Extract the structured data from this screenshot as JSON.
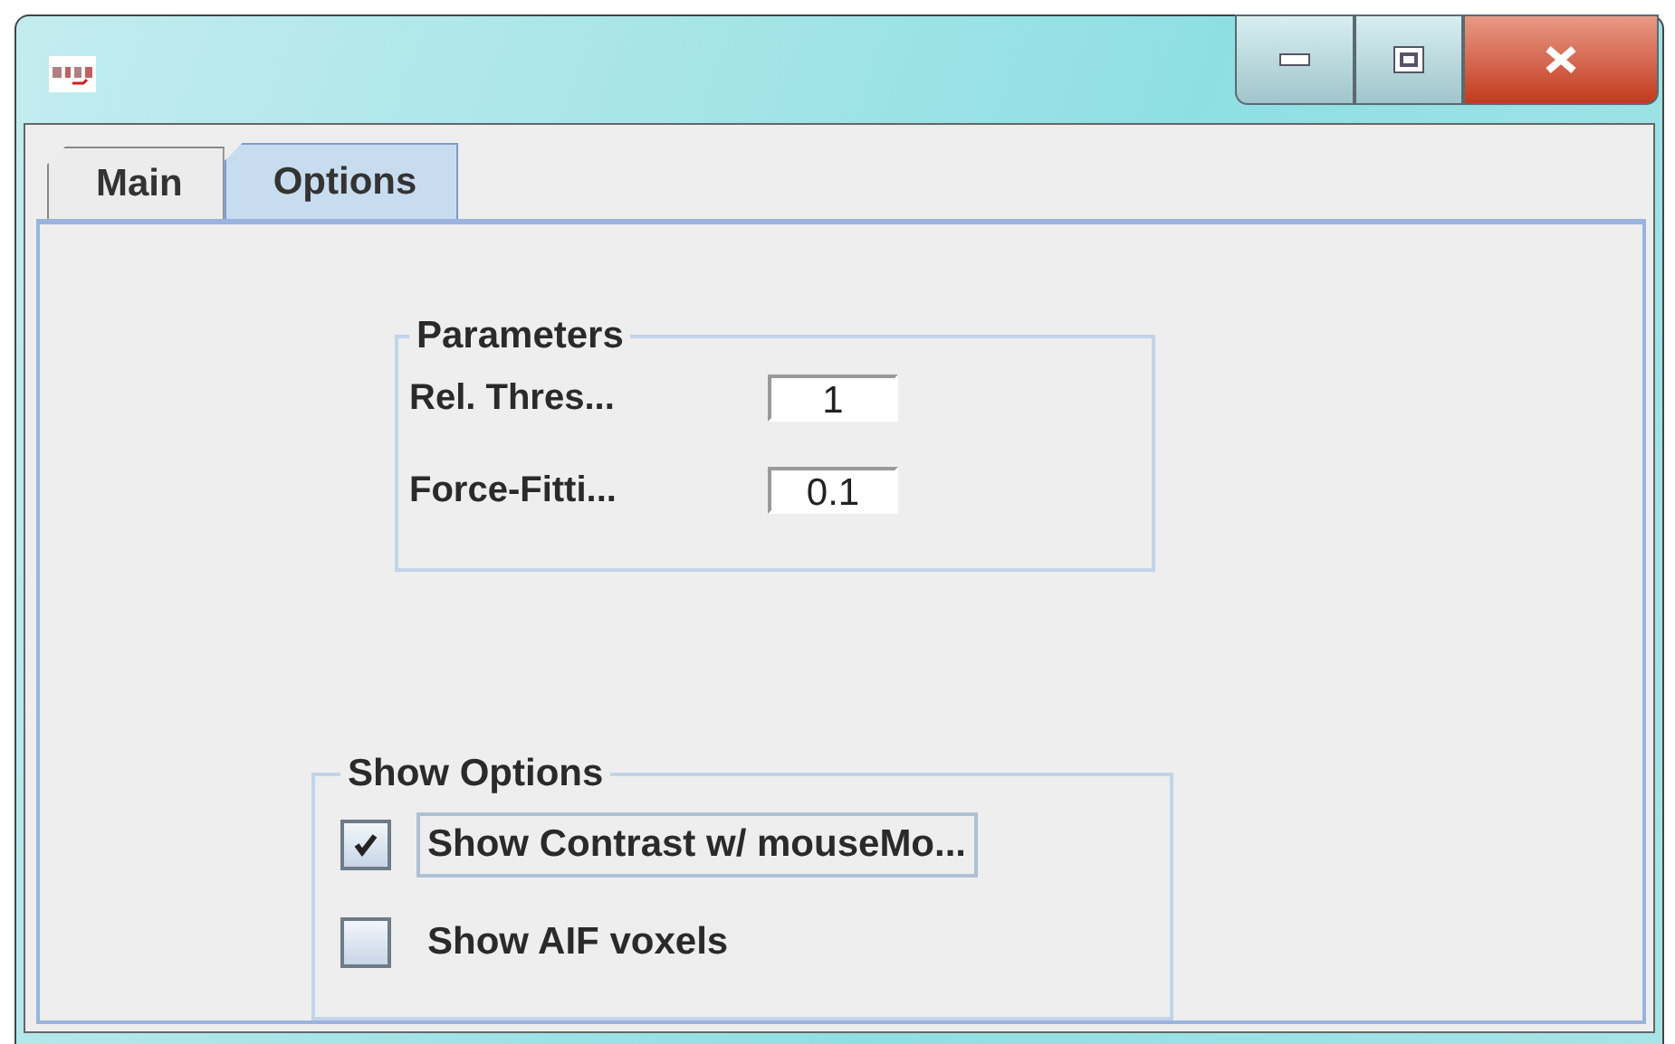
{
  "tabs": [
    {
      "label": "Main",
      "selected": false
    },
    {
      "label": "Options",
      "selected": true
    }
  ],
  "parameters": {
    "title": "Parameters",
    "fields": [
      {
        "label": "Rel. Thres...",
        "value": "1"
      },
      {
        "label": "Force-Fitti...",
        "value": "0.1"
      }
    ]
  },
  "show_options": {
    "title": "Show Options",
    "checkboxes": [
      {
        "label": "Show Contrast w/ mouseMo...",
        "checked": true,
        "focused": true
      },
      {
        "label": "Show AIF voxels",
        "checked": false,
        "focused": false
      }
    ]
  }
}
